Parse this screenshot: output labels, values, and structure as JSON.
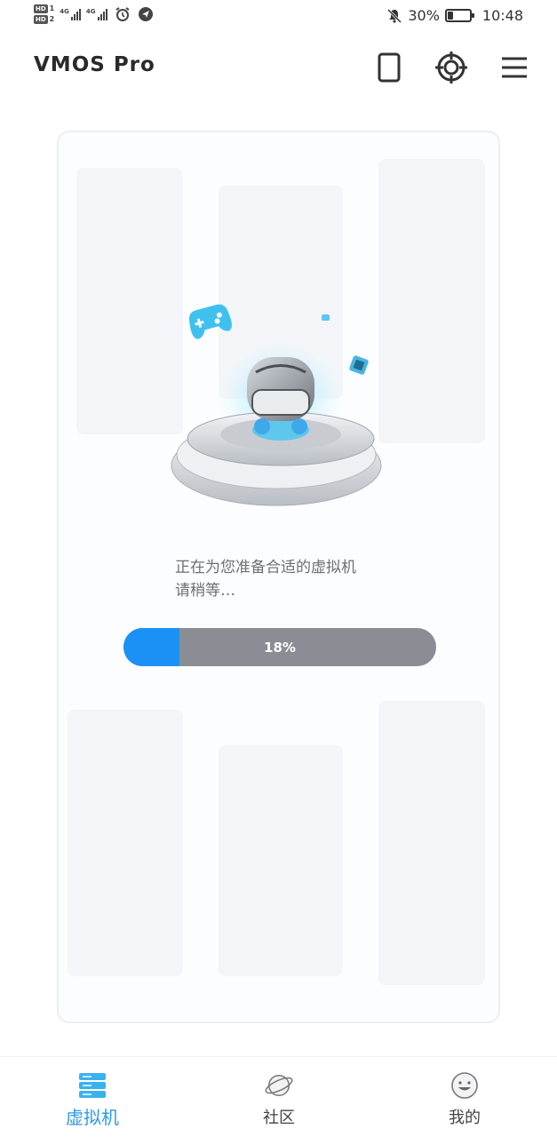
{
  "status_bar": {
    "sim1": "HD",
    "sim1_num": "1",
    "sim2": "HD",
    "sim2_num": "2",
    "network1": "4G",
    "network2": "4G",
    "battery_percent": "30%",
    "battery_level": 0.3,
    "time": "10:48"
  },
  "app_bar": {
    "title": "VMOS Pro",
    "icons": [
      "phone-outline-icon",
      "crosshair-target-icon",
      "hamburger-menu-icon"
    ]
  },
  "main": {
    "message_line1": "正在为您准备合适的虚拟机",
    "message_line2": "请稍等…",
    "progress": {
      "value": 0.18,
      "label": "18%"
    }
  },
  "bottom_nav": {
    "items": [
      {
        "label": "虚拟机",
        "icon": "server-stack-icon",
        "active": true
      },
      {
        "label": "社区",
        "icon": "planet-icon",
        "active": false
      },
      {
        "label": "我的",
        "icon": "smiley-face-icon",
        "active": false
      }
    ]
  },
  "colors": {
    "accent": "#2d9ae6",
    "progress_fill": "#1c91f5",
    "progress_track": "#8a8d93"
  }
}
